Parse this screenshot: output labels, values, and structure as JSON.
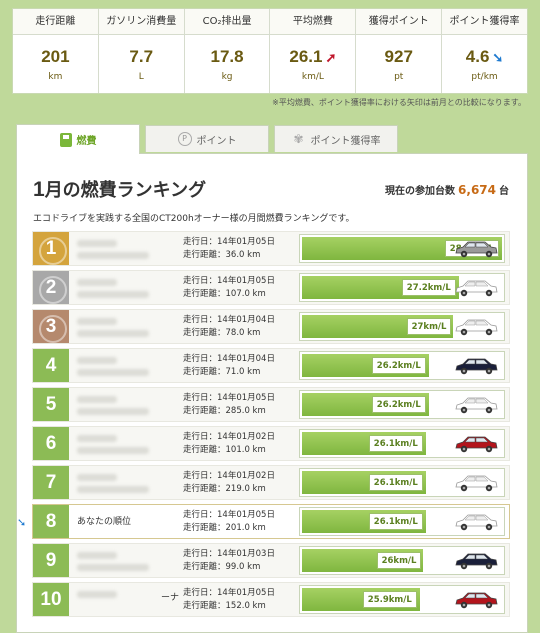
{
  "stats": [
    {
      "label": "走行距離",
      "value": "201",
      "unit": "km",
      "arrow": ""
    },
    {
      "label": "ガソリン消費量",
      "value": "7.7",
      "unit": "L",
      "arrow": ""
    },
    {
      "label": "CO₂排出量",
      "value": "17.8",
      "unit": "kg",
      "arrow": ""
    },
    {
      "label": "平均燃費",
      "value": "26.1",
      "unit": "km/L",
      "arrow": "➚"
    },
    {
      "label": "獲得ポイント",
      "value": "927",
      "unit": "pt",
      "arrow": ""
    },
    {
      "label": "ポイント獲得率",
      "value": "4.6",
      "unit": "pt/km",
      "arrow": "➘"
    }
  ],
  "stats_note": "※平均燃費、ポイント獲得率における矢印は前月との比較になります。",
  "tabs": [
    {
      "label": "燃費",
      "active": true
    },
    {
      "label": "ポイント",
      "active": false
    },
    {
      "label": "ポイント獲得率",
      "active": false
    }
  ],
  "ranking": {
    "title_num": "1",
    "title_rest": "月の燃費ランキング",
    "count_label": "現在の参加台数",
    "count_value": "6,674",
    "count_unit": "台",
    "description": "エコドライブを実践する全国のCT200hオーナー様の月間燃費ランキングです。",
    "date_prefix": "走行日：",
    "dist_prefix": "走行距離：",
    "rows": [
      {
        "rank": "1",
        "name": "",
        "date": "14年01月05日",
        "dist": "36.0 km",
        "fuel": "28.6km/L",
        "fuel_value": 28.6,
        "car_color": "#9a9a9a"
      },
      {
        "rank": "2",
        "name": "",
        "date": "14年01月05日",
        "dist": "107.0 km",
        "fuel": "27.2km/L",
        "fuel_value": 27.2,
        "car_color": "#ffffff"
      },
      {
        "rank": "3",
        "name": "",
        "date": "14年01月04日",
        "dist": "78.0 km",
        "fuel": "27km/L",
        "fuel_value": 27.0,
        "car_color": "#ffffff"
      },
      {
        "rank": "4",
        "name": "",
        "date": "14年01月04日",
        "dist": "71.0 km",
        "fuel": "26.2km/L",
        "fuel_value": 26.2,
        "car_color": "#1a1f3a"
      },
      {
        "rank": "5",
        "name": "",
        "date": "14年01月05日",
        "dist": "285.0 km",
        "fuel": "26.2km/L",
        "fuel_value": 26.2,
        "car_color": "#ffffff"
      },
      {
        "rank": "6",
        "name": "",
        "date": "14年01月02日",
        "dist": "101.0 km",
        "fuel": "26.1km/L",
        "fuel_value": 26.1,
        "car_color": "#b3141c"
      },
      {
        "rank": "7",
        "name": "",
        "date": "14年01月02日",
        "dist": "219.0 km",
        "fuel": "26.1km/L",
        "fuel_value": 26.1,
        "car_color": "#ffffff"
      },
      {
        "rank": "8",
        "name": "あなたの順位",
        "date": "14年01月05日",
        "dist": "201.0 km",
        "fuel": "26.1km/L",
        "fuel_value": 26.1,
        "car_color": "#ffffff",
        "mine": true
      },
      {
        "rank": "9",
        "name": "",
        "date": "14年01月03日",
        "dist": "99.0 km",
        "fuel": "26km/L",
        "fuel_value": 26.0,
        "car_color": "#1a1f3a"
      },
      {
        "rank": "10",
        "name": "ーナ",
        "date": "14年01月05日",
        "dist": "152.0 km",
        "fuel": "25.9km/L",
        "fuel_value": 25.9,
        "car_color": "#b3141c"
      }
    ]
  },
  "colors": {
    "accent_green": "#7fb63f",
    "value_brown": "#6a5a12",
    "count_orange": "#c76a15",
    "arrow_up": "#c0152b",
    "arrow_down": "#1e7ad0"
  }
}
